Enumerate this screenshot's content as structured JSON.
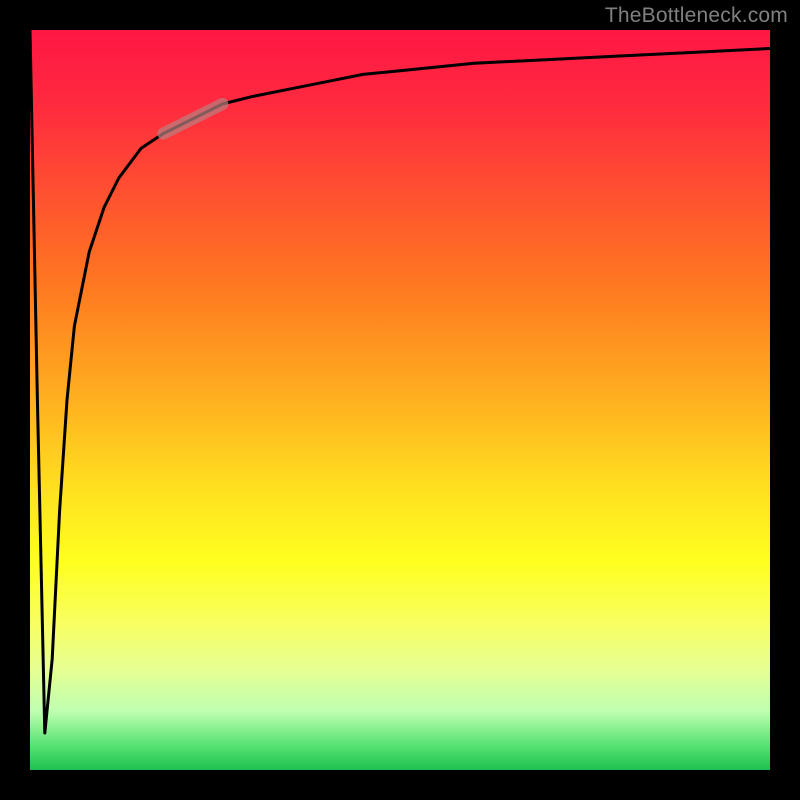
{
  "watermark": "TheBottleneck.com",
  "chart_data": {
    "type": "line",
    "title": "",
    "xlabel": "",
    "ylabel": "",
    "xlim": [
      0,
      100
    ],
    "ylim": [
      0,
      100
    ],
    "grid": false,
    "legend": false,
    "background_gradient": {
      "direction": "vertical",
      "stops": [
        {
          "pos": 0,
          "color": "#ff1744"
        },
        {
          "pos": 50,
          "color": "#ffe020"
        },
        {
          "pos": 72,
          "color": "#ffff20"
        },
        {
          "pos": 100,
          "color": "#20c050"
        }
      ]
    },
    "series": [
      {
        "name": "bottleneck-curve",
        "color": "#000000",
        "x": [
          0,
          1,
          2,
          3,
          4,
          5,
          6,
          8,
          10,
          12,
          15,
          18,
          22,
          26,
          30,
          35,
          40,
          45,
          50,
          55,
          60,
          70,
          80,
          90,
          100
        ],
        "values": [
          100,
          50,
          5,
          15,
          35,
          50,
          60,
          70,
          76,
          80,
          84,
          86,
          88,
          90,
          91,
          92,
          93,
          94,
          94.5,
          95,
          95.5,
          96,
          96.5,
          97,
          97.5
        ]
      }
    ],
    "highlight_segment": {
      "series": "bottleneck-curve",
      "x_start": 18,
      "x_end": 26,
      "color": "#b88080",
      "opacity": 0.7
    }
  }
}
